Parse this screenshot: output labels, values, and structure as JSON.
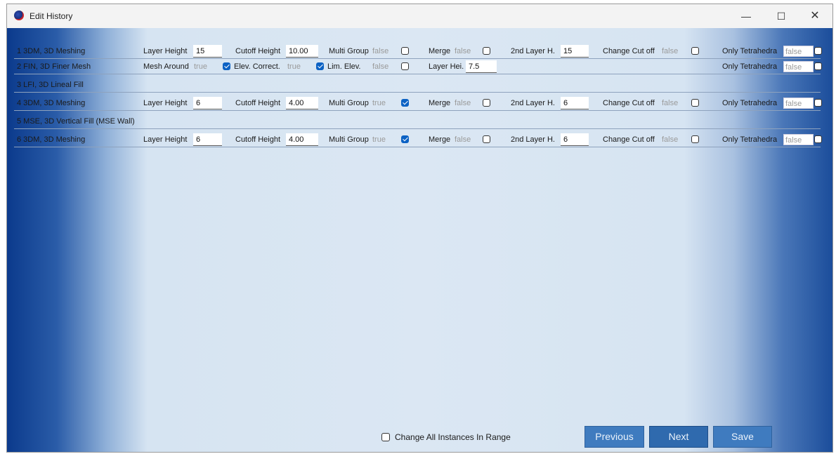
{
  "window": {
    "title": "Edit History",
    "controls": {
      "minimize": "—",
      "maximize": "☐",
      "close": "✕"
    }
  },
  "rows": [
    {
      "name": "1 3DM, 3D Meshing",
      "layer_height_label": "Layer Height",
      "layer_height": "15",
      "cutoff_height_label": "Cutoff Height",
      "cutoff_height": "10.00",
      "multi_group_label": "Multi Group",
      "multi_group": "false",
      "merge_label": "Merge",
      "merge": "false",
      "second_layer_label": "2nd Layer H.",
      "second_layer": "15",
      "change_cutoff_label": "Change Cut off",
      "change_cutoff": "false",
      "only_tetra_label": "Only Tetrahedra",
      "only_tetra": "false"
    },
    {
      "name": "2 FIN, 3D Finer Mesh",
      "mesh_around_label": "Mesh Around",
      "mesh_around": "true",
      "elev_correct_label": "Elev. Correct.",
      "elev_correct": "true",
      "lim_elev_label": "Lim. Elev.",
      "lim_elev": "false",
      "layer_hei_label": "Layer Hei.",
      "layer_hei": "7.5",
      "only_tetra_label": "Only Tetrahedra",
      "only_tetra": "false"
    },
    {
      "name": "3 LFI, 3D Lineal Fill"
    },
    {
      "name": "4 3DM, 3D Meshing",
      "layer_height_label": "Layer Height",
      "layer_height": "6",
      "cutoff_height_label": "Cutoff Height",
      "cutoff_height": "4.00",
      "multi_group_label": "Multi Group",
      "multi_group": "true",
      "merge_label": "Merge",
      "merge": "false",
      "second_layer_label": "2nd Layer H.",
      "second_layer": "6",
      "change_cutoff_label": "Change Cut off",
      "change_cutoff": "false",
      "only_tetra_label": "Only Tetrahedra",
      "only_tetra": "false"
    },
    {
      "name": "5 MSE, 3D Vertical Fill (MSE Wall)"
    },
    {
      "name": "6 3DM, 3D Meshing",
      "layer_height_label": "Layer Height",
      "layer_height": "6",
      "cutoff_height_label": "Cutoff Height",
      "cutoff_height": "4.00",
      "multi_group_label": "Multi Group",
      "multi_group": "true",
      "merge_label": "Merge",
      "merge": "false",
      "second_layer_label": "2nd Layer H.",
      "second_layer": "6",
      "change_cutoff_label": "Change Cut off",
      "change_cutoff": "false",
      "only_tetra_label": "Only Tetrahedra",
      "only_tetra": "false"
    }
  ],
  "footer": {
    "change_all_label": "Change All Instances In Range",
    "change_all_checked": false,
    "previous_label": "Previous",
    "next_label": "Next",
    "save_label": "Save"
  },
  "colors": {
    "accent": "#0c62c4",
    "button": "#3f7bbf",
    "edge_blue": "#0b3a8c"
  }
}
